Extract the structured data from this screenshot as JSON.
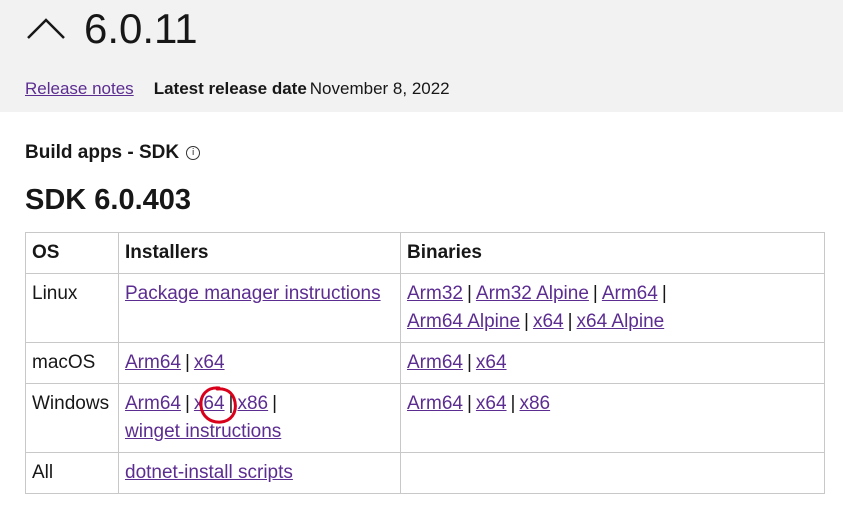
{
  "header": {
    "version": "6.0.11",
    "release_notes": "Release notes",
    "latest_label": "Latest release date",
    "latest_date": "November 8, 2022"
  },
  "section": {
    "build_label": "Build apps - SDK",
    "info_icon": "ⓘ",
    "sdk_title": "SDK 6.0.403"
  },
  "table": {
    "headers": [
      "OS",
      "Installers",
      "Binaries"
    ],
    "rows": [
      {
        "os": "Linux",
        "installers": [
          "Package manager instructions"
        ],
        "binaries": [
          "Arm32",
          "Arm32 Alpine",
          "Arm64",
          "Arm64 Alpine",
          "x64",
          "x64 Alpine"
        ]
      },
      {
        "os": "macOS",
        "installers": [
          "Arm64",
          "x64"
        ],
        "binaries": [
          "Arm64",
          "x64"
        ]
      },
      {
        "os": "Windows",
        "installers": [
          "Arm64",
          "x64",
          "x86",
          "winget instructions"
        ],
        "binaries": [
          "Arm64",
          "x64",
          "x86"
        ]
      },
      {
        "os": "All",
        "installers": [
          "dotnet-install scripts"
        ],
        "binaries": []
      }
    ]
  },
  "colors": {
    "link": "#5c2d91",
    "header_bg": "#f2f2f2",
    "annotation": "#d9001b"
  },
  "icons": [
    "chevron-up-icon",
    "info-icon"
  ]
}
